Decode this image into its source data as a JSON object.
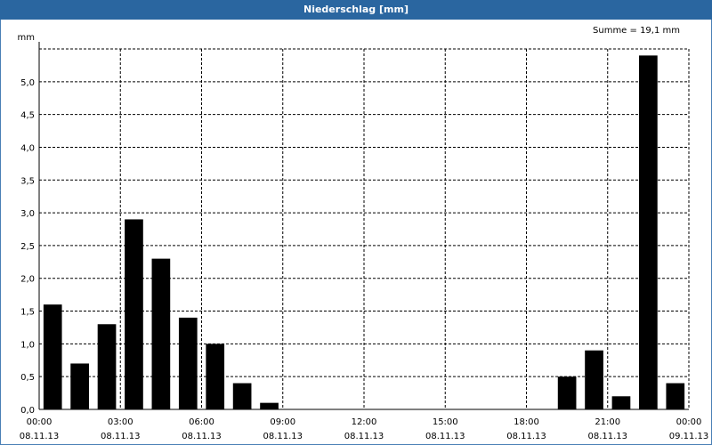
{
  "window": {
    "title": "Niederschlag [mm]"
  },
  "chart_data": {
    "type": "bar",
    "title": "Niederschlag [mm]",
    "ylabel": "mm",
    "annotation": "Summe = 19,1 mm",
    "ylim": [
      0,
      5.5
    ],
    "yticks": [
      "0,0",
      "0,5",
      "1,0",
      "1,5",
      "2,0",
      "2,5",
      "3,0",
      "3,5",
      "4,0",
      "4,5",
      "5,0"
    ],
    "xticks": [
      {
        "time": "00:00",
        "date": "08.11.13"
      },
      {
        "time": "03:00",
        "date": "08.11.13"
      },
      {
        "time": "06:00",
        "date": "08.11.13"
      },
      {
        "time": "09:00",
        "date": "08.11.13"
      },
      {
        "time": "12:00",
        "date": "08.11.13"
      },
      {
        "time": "15:00",
        "date": "08.11.13"
      },
      {
        "time": "18:00",
        "date": "08.11.13"
      },
      {
        "time": "21:00",
        "date": "08.11.13"
      },
      {
        "time": "00:00",
        "date": "09.11.13"
      }
    ],
    "categories": [
      "00:00",
      "01:00",
      "02:00",
      "03:00",
      "04:00",
      "05:00",
      "06:00",
      "07:00",
      "08:00",
      "09:00",
      "10:00",
      "11:00",
      "12:00",
      "13:00",
      "14:00",
      "15:00",
      "16:00",
      "17:00",
      "18:00",
      "19:00",
      "20:00",
      "21:00",
      "22:00",
      "23:00"
    ],
    "values": [
      1.6,
      0.7,
      1.3,
      2.9,
      2.3,
      1.4,
      1.0,
      0.4,
      0.1,
      0,
      0,
      0,
      0,
      0,
      0,
      0,
      0,
      0,
      0,
      0.5,
      0.9,
      0.2,
      5.4,
      0.4
    ],
    "grid": true,
    "colors": {
      "bar": "#000000",
      "titlebar": "#2a66a0",
      "grid": "#000000"
    }
  }
}
